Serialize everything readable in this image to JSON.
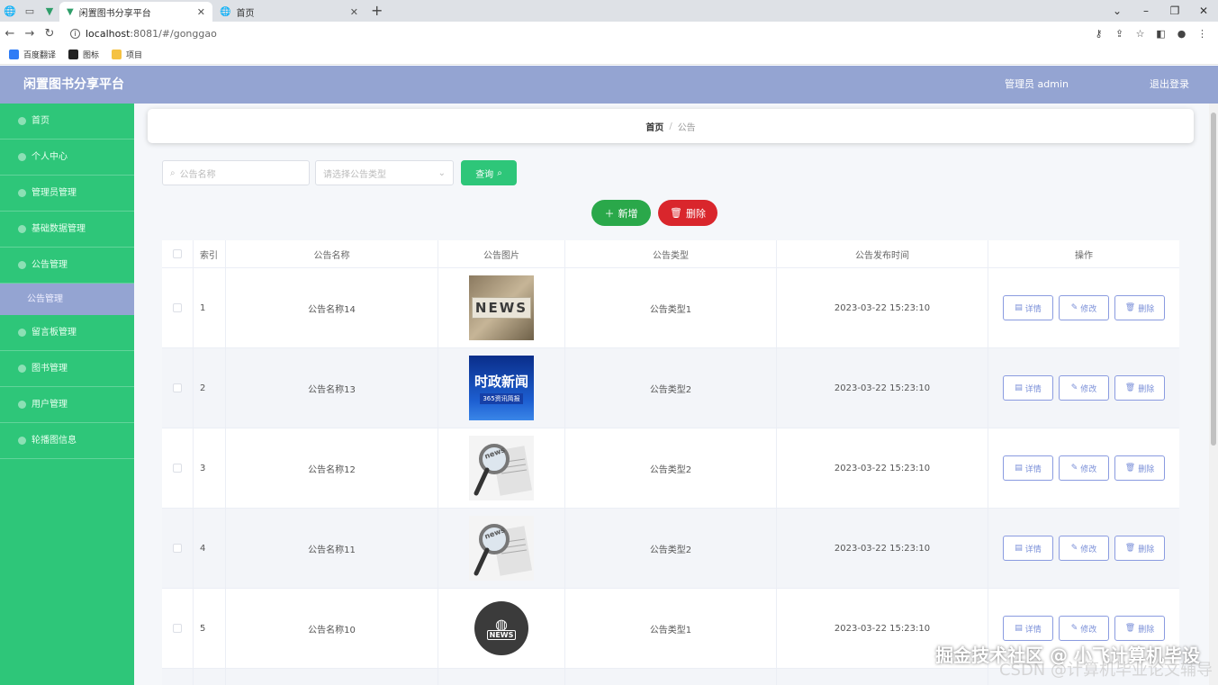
{
  "browser": {
    "tabs": [
      {
        "title": "闲置图书分享平台",
        "active": true
      },
      {
        "title": "首页",
        "active": false
      }
    ],
    "url_host": "localhost",
    "url_path": ":8081/#/gonggao",
    "bookmarks": [
      {
        "label": "百度翻译",
        "color": "#2f7cf6"
      },
      {
        "label": "图标",
        "color": "#222222"
      },
      {
        "label": "项目",
        "color": "#f5c242"
      }
    ]
  },
  "header": {
    "title": "闲置图书分享平台",
    "user": "管理员 admin",
    "logout": "退出登录"
  },
  "sidebar": {
    "items": [
      {
        "label": "首页"
      },
      {
        "label": "个人中心"
      },
      {
        "label": "管理员管理"
      },
      {
        "label": "基础数据管理"
      },
      {
        "label": "公告管理"
      }
    ],
    "active_sub": "公告管理",
    "items_after": [
      {
        "label": "留言板管理"
      },
      {
        "label": "图书管理"
      },
      {
        "label": "用户管理"
      },
      {
        "label": "轮播图信息"
      }
    ]
  },
  "breadcrumb": {
    "home": "首页",
    "separator": "/",
    "current": "公告"
  },
  "search": {
    "name_placeholder": "公告名称",
    "type_placeholder": "请选择公告类型",
    "query_label": "查询"
  },
  "actions": {
    "add_label": "新增",
    "delete_label": "删除"
  },
  "table": {
    "headers": {
      "index": "索引",
      "name": "公告名称",
      "image": "公告图片",
      "type": "公告类型",
      "time": "公告发布时间",
      "ops": "操作"
    },
    "op_labels": {
      "detail": "详情",
      "edit": "修改",
      "delete": "删除"
    },
    "rows": [
      {
        "index": "1",
        "name": "公告名称14",
        "image": "NEWS",
        "type": "公告类型1",
        "time": "2023-03-22 15:23:10"
      },
      {
        "index": "2",
        "name": "公告名称13",
        "image": "时政新闻",
        "image_sub": "365资讯简报",
        "type": "公告类型2",
        "time": "2023-03-22 15:23:10"
      },
      {
        "index": "3",
        "name": "公告名称12",
        "image": "news",
        "type": "公告类型2",
        "time": "2023-03-22 15:23:10"
      },
      {
        "index": "4",
        "name": "公告名称11",
        "image": "news",
        "type": "公告类型2",
        "time": "2023-03-22 15:23:10"
      },
      {
        "index": "5",
        "name": "公告名称10",
        "image": "NEWS",
        "type": "公告类型1",
        "time": "2023-03-22 15:23:10"
      }
    ]
  },
  "watermark": {
    "text": "掘金技术社区 @ 小飞计算机毕设",
    "text2": "CSDN @计算机毕业论文辅导"
  },
  "colors": {
    "accent_green": "#2ec679",
    "header_blue": "#94a4d2",
    "add_green": "#2aa84a",
    "delete_red": "#d9262c"
  }
}
